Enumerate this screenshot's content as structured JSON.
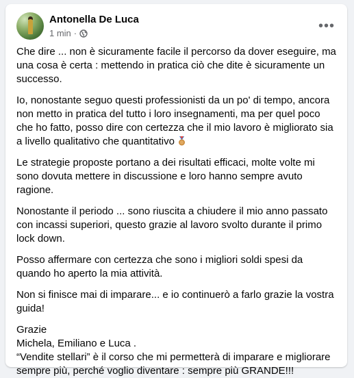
{
  "post": {
    "author": "Antonella De Luca",
    "timestamp": "1 min",
    "meta_separator": "·",
    "privacy_icon": "globe-icon",
    "more_options_icon": "more-horizontal-icon",
    "more_label": "•••",
    "paragraphs": [
      "Che dire ... non è sicuramente facile il percorso da dover eseguire, ma una cosa è certa : mettendo in pratica ciò che dite è sicuramente un successo.",
      "Io, nonostante seguo questi professionisti da un po' di tempo, ancora non metto in pratica del tutto i loro insegnamenti, ma per quel poco che ho fatto, posso dire con certezza che il mio lavoro è migliorato sia a livello qualitativo che quantitativo",
      "Le strategie proposte portano a dei risultati efficaci, molte volte mi sono dovuta mettere in discussione e loro hanno sempre avuto ragione.",
      "Nonostante il periodo ... sono riuscita a chiudere il mio anno passato con incassi superiori, questo grazie al lavoro svolto durante il primo lock down.",
      "Posso affermare con certezza che sono i migliori soldi spesi da quando ho aperto la mia attività.",
      "Non si finisce mai di imparare... e io continuerò a farlo grazie la vostra guida!"
    ],
    "emoji_icon": "bronze-medal-icon",
    "closing": {
      "line1": "Grazie",
      "line2": "Michela, Emiliano e Luca .",
      "line3": "“Vendite stellari” è il corso che mi permetterà di imparare e migliorare sempre più, perché voglio diventare : sempre più GRANDE!!!"
    }
  }
}
